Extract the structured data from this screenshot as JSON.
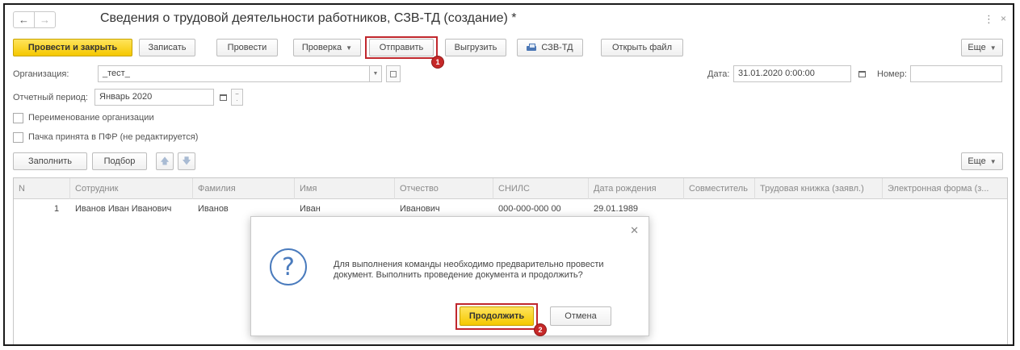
{
  "window": {
    "title": "Сведения о трудовой деятельности работников, СЗВ-ТД (создание) *",
    "back_icon": "arrow-left-icon",
    "forward_icon": "arrow-right-icon",
    "menu_glyph": "⋮",
    "close_glyph": "×"
  },
  "toolbar": {
    "post_close": "Провести и закрыть",
    "save": "Записать",
    "post": "Провести",
    "check": "Проверка",
    "send": "Отправить",
    "upload": "Выгрузить",
    "print_szv": "СЗВ-ТД",
    "open_file": "Открыть файл",
    "more": "Еще"
  },
  "callouts": {
    "first": "1",
    "second": "2"
  },
  "form": {
    "org_label": "Организация:",
    "org_value": "_тест_",
    "date_label": "Дата:",
    "date_value": "31.01.2020  0:00:00",
    "number_label": "Номер:",
    "number_value": "",
    "period_label": "Отчетный период:",
    "period_value": "Январь 2020",
    "rename_org_label": "Переименование организации",
    "rename_org_checked": false,
    "batch_accepted_label": "Пачка принята в ПФР (не редактируется)",
    "batch_accepted_checked": false
  },
  "table_toolbar": {
    "fill": "Заполнить",
    "select": "Подбор",
    "more": "Еще"
  },
  "table": {
    "columns": [
      "N",
      "Сотрудник",
      "Фамилия",
      "Имя",
      "Отчество",
      "СНИЛС",
      "Дата рождения",
      "Совместитель",
      "Трудовая книжка (заявл.)",
      "Электронная форма (з..."
    ],
    "rows": [
      [
        "1",
        "Иванов Иван Иванович",
        "Иванов",
        "Иван",
        "Иванович",
        "000-000-000 00",
        "29.01.1989",
        "",
        "",
        ""
      ]
    ]
  },
  "dialog": {
    "icon": "question-icon",
    "message": "Для выполнения команды необходимо предварительно провести документ. Выполнить проведение документа и продолжить?",
    "continue": "Продолжить",
    "cancel": "Отмена"
  },
  "colors": {
    "primary_button": "#f5c800",
    "callout_red": "#c62828",
    "question_icon": "#4a7bbd"
  }
}
